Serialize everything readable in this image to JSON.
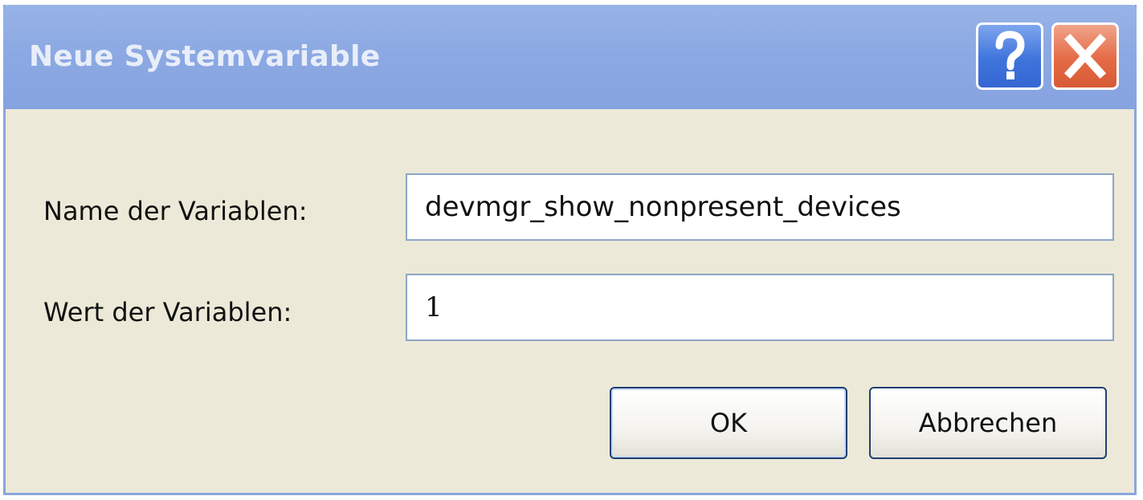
{
  "window": {
    "title": "Neue Systemvariable",
    "help_button": "?",
    "close_button": "close"
  },
  "form": {
    "name_label": "Name der Variablen:",
    "name_value": "devmgr_show_nonpresent_devices",
    "value_label": "Wert der Variablen:",
    "value_value": "1"
  },
  "buttons": {
    "ok_label": "OK",
    "cancel_label": "Abbrechen"
  },
  "icons": {
    "help": "help-question-icon",
    "close": "close-x-icon"
  },
  "colors": {
    "titlebar": "#8ca9e3",
    "dialog_background": "#ece9d8",
    "help_button": "#3e74dc",
    "close_button": "#e46a46"
  }
}
